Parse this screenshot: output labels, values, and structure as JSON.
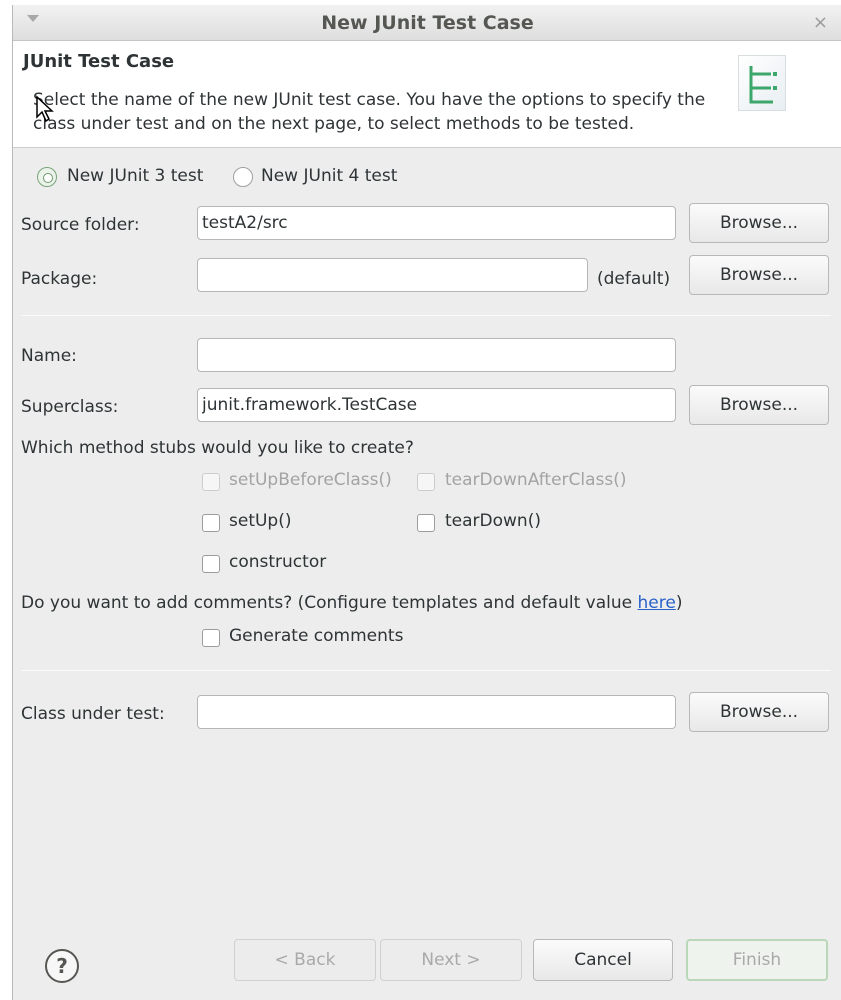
{
  "window": {
    "title": "New JUnit Test Case",
    "close_glyph": "×",
    "menu_icon": "window-menu-icon"
  },
  "banner": {
    "title": "JUnit Test Case",
    "description": "Select the name of the new JUnit test case. You have the options to specify the class under test and on the next page, to select methods to be tested.",
    "icon": "junit-wizard-icon"
  },
  "version": {
    "option3": "New JUnit 3 test",
    "option4": "New JUnit 4 test",
    "selected": "New JUnit 3 test"
  },
  "source_folder": {
    "label": "Source folder:",
    "value": "testA2/src",
    "browse": "Browse..."
  },
  "package": {
    "label": "Package:",
    "value": "",
    "default_hint": "(default)",
    "browse": "Browse..."
  },
  "name": {
    "label": "Name:",
    "value": ""
  },
  "superclass": {
    "label": "Superclass:",
    "value": "junit.framework.TestCase",
    "browse": "Browse..."
  },
  "stubs": {
    "question": "Which method stubs would you like to create?",
    "setUpBeforeClass": "setUpBeforeClass()",
    "tearDownAfterClass": "tearDownAfterClass()",
    "setUp": "setUp()",
    "tearDown": "tearDown()",
    "constructor": "constructor"
  },
  "comments": {
    "question": "Do you want to add comments? (Configure templates and default value ",
    "link": "here",
    "close": ")",
    "generate": "Generate comments"
  },
  "class_under_test": {
    "label": "Class under test:",
    "value": "",
    "browse": "Browse..."
  },
  "footer": {
    "help": "?",
    "back": "< Back",
    "next": "Next >",
    "cancel": "Cancel",
    "finish": "Finish"
  },
  "colors": {
    "dialog_bg": "#ededed",
    "accent_green": "#7aa37a",
    "link": "#2a62c9"
  }
}
